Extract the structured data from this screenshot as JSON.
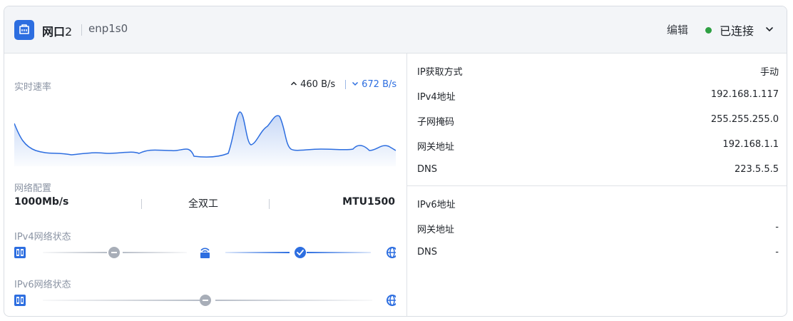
{
  "header": {
    "port_name": "网口",
    "port_num": "2",
    "interface": "enp1s0",
    "edit_label": "编辑",
    "status_text": "已连接",
    "status_color": "#2ea043"
  },
  "realtime": {
    "label": "实时速率",
    "upload": "460 B/s",
    "download": "672 B/s"
  },
  "net_config": {
    "label": "网络配置",
    "speed": "1000Mb/s",
    "duplex": "全双工",
    "mtu": "MTU1500"
  },
  "ipv4_status": {
    "label": "IPv4网络状态",
    "nodes": [
      "device-icon",
      "pending-status-icon",
      "router-icon",
      "connected-check-icon",
      "internet-globe-icon"
    ]
  },
  "ipv6_status": {
    "label": "IPv6网络状态",
    "nodes": [
      "device-icon",
      "pending-status-icon",
      "internet-globe-icon"
    ]
  },
  "ipv4_info": [
    {
      "key": "IP获取方式",
      "value": "手动"
    },
    {
      "key": "IPv4地址",
      "value": "192.168.1.117"
    },
    {
      "key": "子网掩码",
      "value": "255.255.255.0"
    },
    {
      "key": "网关地址",
      "value": "192.168.1.1"
    },
    {
      "key": "DNS",
      "value": "223.5.5.5"
    }
  ],
  "ipv6_info": [
    {
      "key": "IPv6地址",
      "value": ""
    },
    {
      "key": "网关地址",
      "value": "-"
    },
    {
      "key": "DNS",
      "value": "-"
    }
  ],
  "colors": {
    "accent": "#2d6ee0",
    "line_inactive": "#b8bec8"
  }
}
